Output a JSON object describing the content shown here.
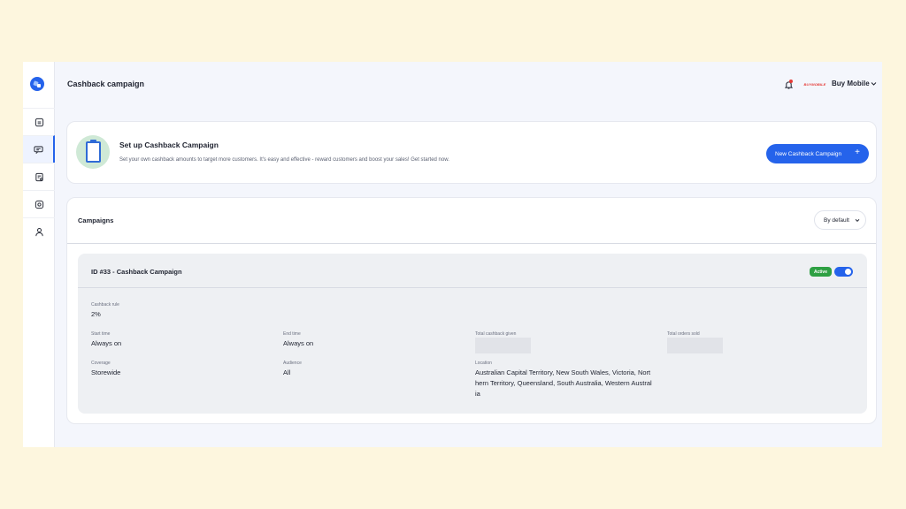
{
  "header": {
    "title": "Cashback campaign",
    "store_name": "Buy Mobile",
    "brand_logo_text": "BUYMOBILE"
  },
  "sidebar": {
    "items": [
      {
        "icon": "store-icon",
        "active": false
      },
      {
        "icon": "campaign-icon",
        "active": true
      },
      {
        "icon": "orders-icon",
        "active": false
      },
      {
        "icon": "settings-icon",
        "active": false
      },
      {
        "icon": "user-icon",
        "active": false
      }
    ]
  },
  "setup": {
    "title": "Set up Cashback Campaign",
    "description": "Set your own cashback amounts to target more customers. It's easy and effective - reward customers and boost your sales! Get started now.",
    "button_label": "New Cashback Campaign",
    "button_icon": "+"
  },
  "campaigns": {
    "title": "Campaigns",
    "sort_label": "By default",
    "items": [
      {
        "name": "ID #33 - Cashback Campaign",
        "status": "Active",
        "enabled": true,
        "cashback_rule_label": "Cashback rule",
        "cashback_rule_value": "2%",
        "start_time_label": "Start time",
        "start_time_value": "Always on",
        "end_time_label": "End time",
        "end_time_value": "Always on",
        "total_cashback_label": "Total cashback given",
        "total_orders_label": "Total orders sold",
        "coverage_label": "Coverage",
        "coverage_value": "Storewide",
        "audience_label": "Audience",
        "audience_value": "All",
        "location_label": "Location",
        "location_lines": [
          "Australian Capital Territory, New South Wales, Victoria, Nort",
          "hern Territory, Queensland, South Australia, Western Austral",
          "ia"
        ]
      }
    ]
  },
  "colors": {
    "accent": "#2563eb",
    "active_badge": "#2ea043",
    "notification_dot": "#e53935",
    "page_background": "#fdf6de"
  }
}
